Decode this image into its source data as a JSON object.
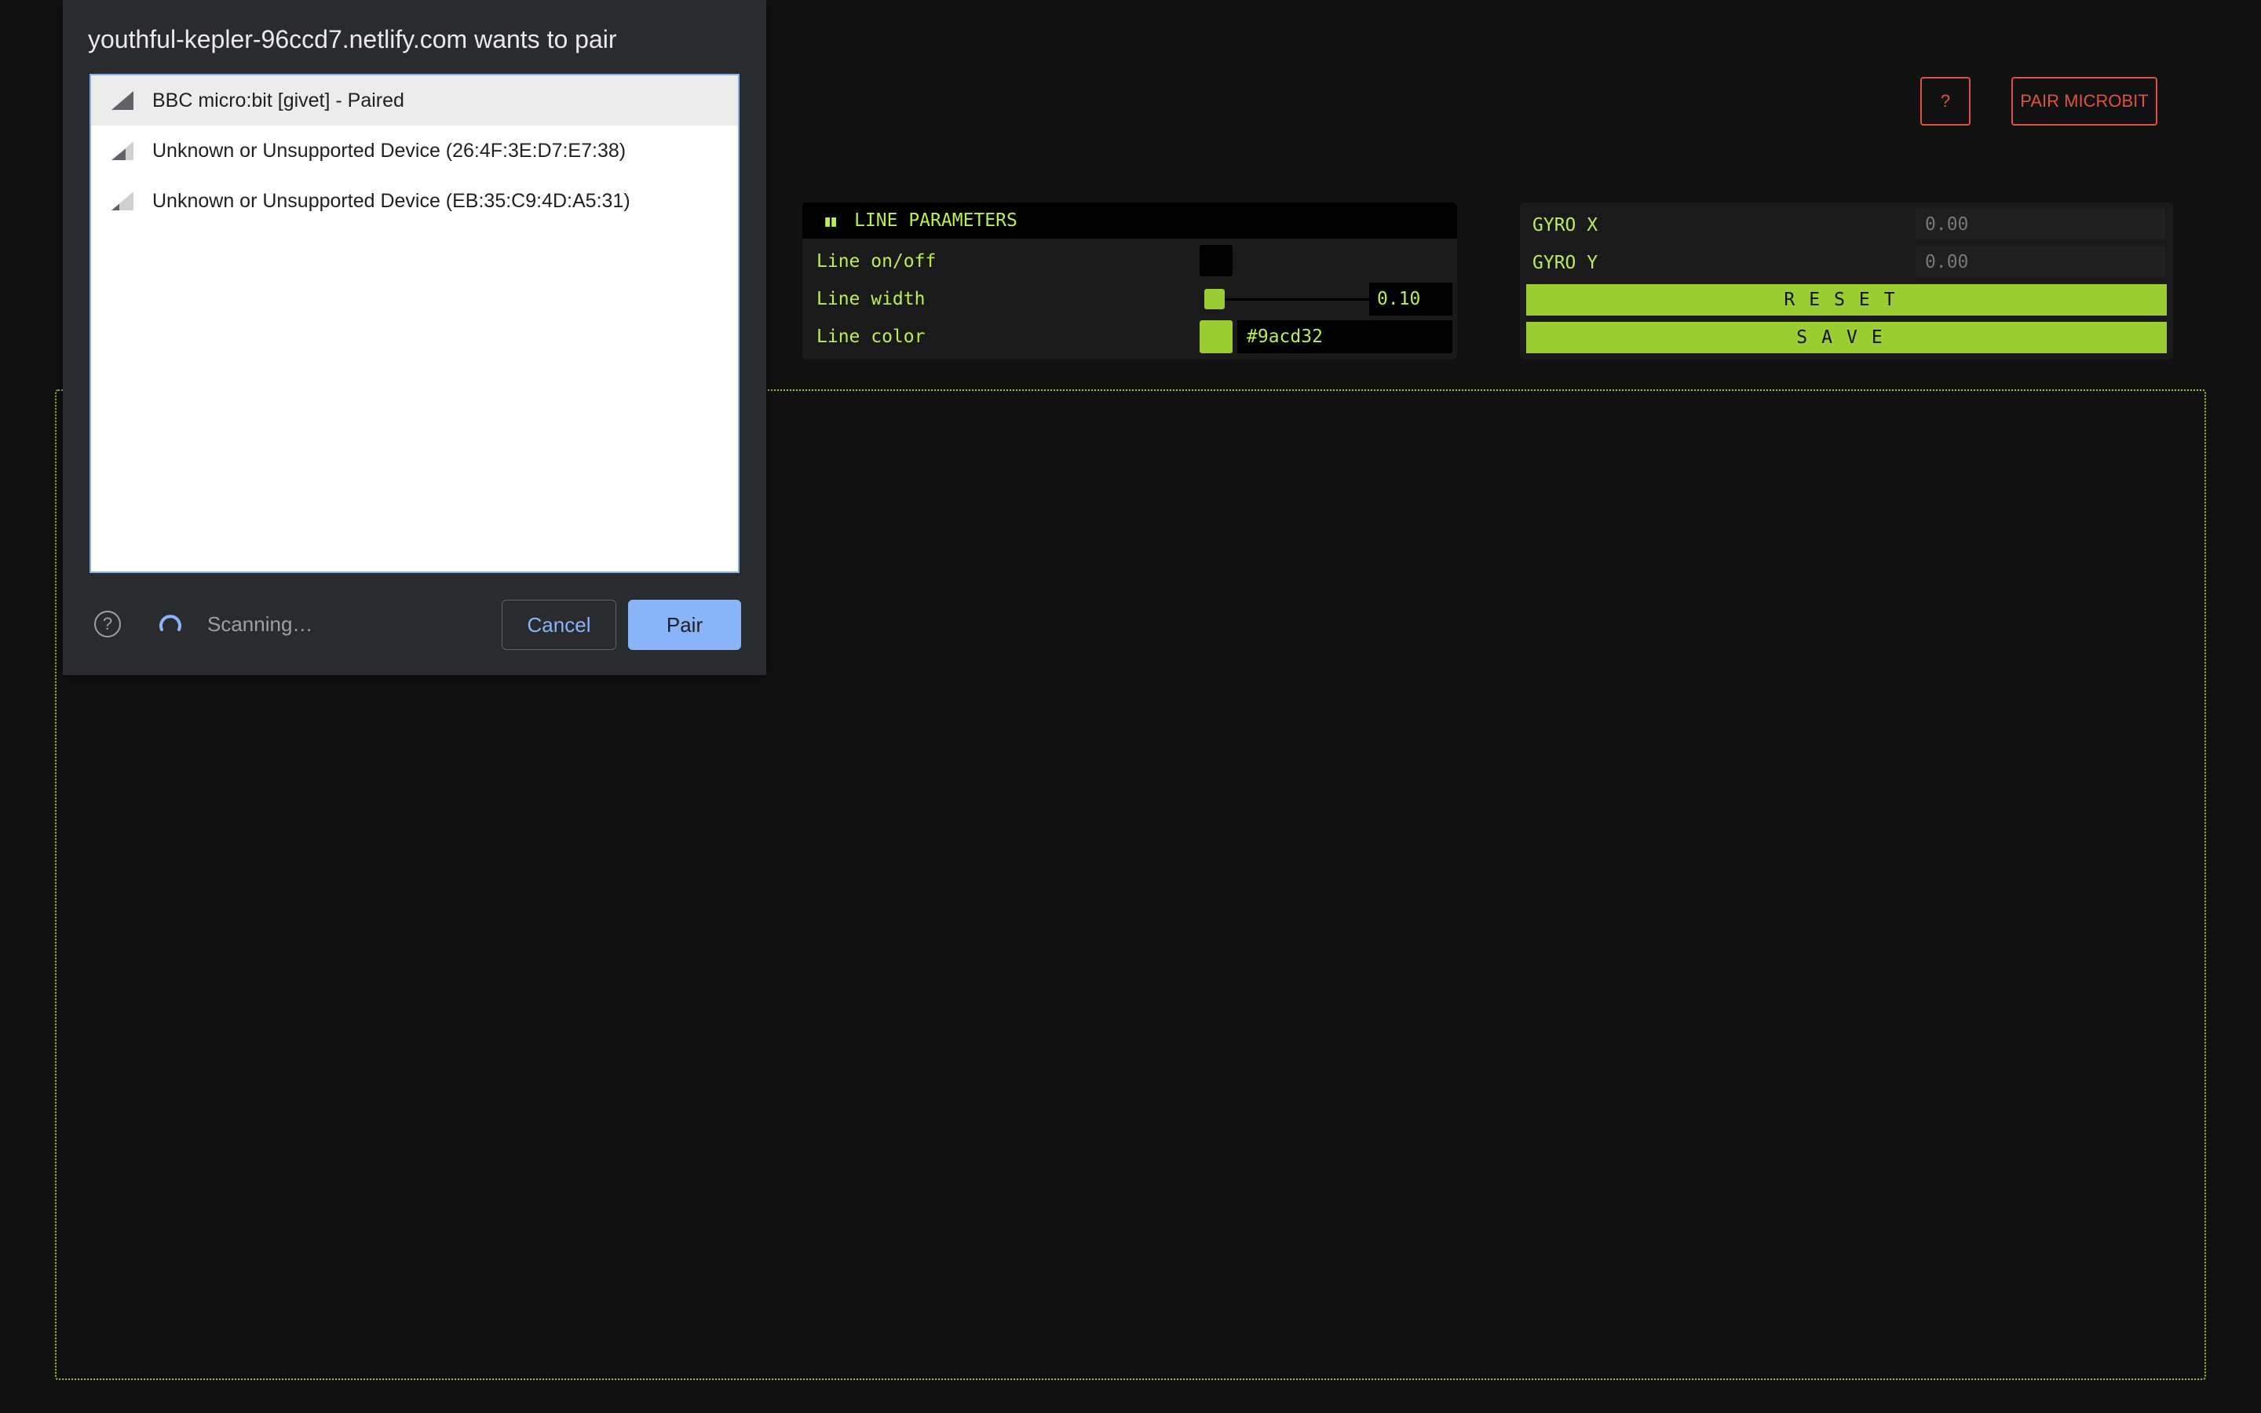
{
  "header": {
    "help_label": "?",
    "pair_label": "PAIR MICROBIT",
    "accent_color": "#e0523e"
  },
  "line_panel": {
    "title": "LINE PARAMETERS",
    "collapse_icon": "pause-icon",
    "rows": {
      "on_off_label": "Line on/off",
      "width_label": "Line width",
      "width_value": "0.10",
      "color_label": "Line color",
      "color_value": "#9acd32"
    }
  },
  "gyro_panel": {
    "x_label": "GYRO X",
    "x_value": "0.00",
    "y_label": "GYRO Y",
    "y_value": "0.00",
    "reset_label": "RESET",
    "save_label": "SAVE"
  },
  "theme": {
    "accent_green": "#9acd32",
    "background": "#111111"
  },
  "dialog": {
    "title": "youthful-kepler-96ccd7.netlify.com wants to pair",
    "devices": [
      {
        "label": "BBC micro:bit [givet] - Paired",
        "selected": true
      },
      {
        "label": "Unknown or Unsupported Device (26:4F:3E:D7:E7:38)",
        "selected": false
      },
      {
        "label": "Unknown or Unsupported Device (EB:35:C9:4D:A5:31)",
        "selected": false
      }
    ],
    "help_glyph": "?",
    "status_text": "Scanning…",
    "cancel_label": "Cancel",
    "pair_label": "Pair"
  }
}
